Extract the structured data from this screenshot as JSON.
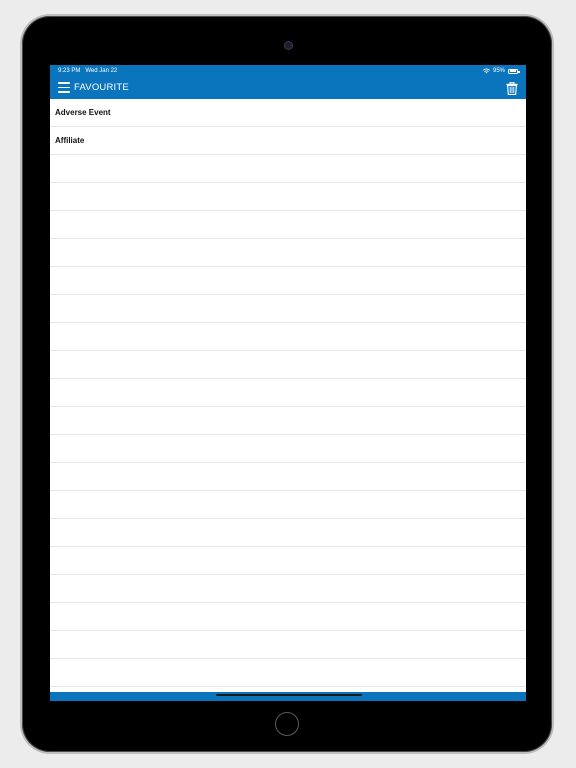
{
  "status_bar": {
    "time": "9:23 PM",
    "date": "Wed Jan 22",
    "battery_percent_label": "95%",
    "battery_level": 0.95,
    "wifi_icon": "wifi-icon",
    "battery_icon": "battery-icon"
  },
  "nav": {
    "title": "FAVOURITE",
    "menu_icon": "hamburger-menu-icon",
    "trash_icon": "trash-icon"
  },
  "favourites": {
    "items": [
      {
        "label": "Adverse Event"
      },
      {
        "label": "Affiliate"
      },
      {
        "label": ""
      },
      {
        "label": ""
      },
      {
        "label": ""
      },
      {
        "label": ""
      },
      {
        "label": ""
      },
      {
        "label": ""
      },
      {
        "label": ""
      },
      {
        "label": ""
      },
      {
        "label": ""
      },
      {
        "label": ""
      },
      {
        "label": ""
      },
      {
        "label": ""
      },
      {
        "label": ""
      },
      {
        "label": ""
      },
      {
        "label": ""
      },
      {
        "label": ""
      },
      {
        "label": ""
      },
      {
        "label": ""
      },
      {
        "label": ""
      },
      {
        "label": ""
      }
    ]
  },
  "colors": {
    "accent": "#0a74bd",
    "background": "#ffffff",
    "divider": "#e6e6e6",
    "device_frame": "#000000"
  }
}
